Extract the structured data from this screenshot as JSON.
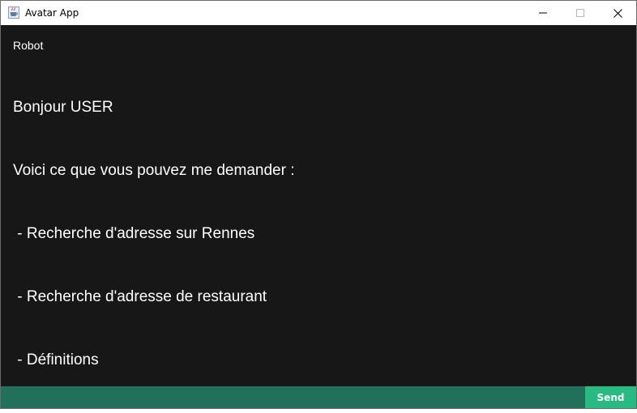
{
  "window": {
    "title": "Avatar App",
    "icon": "java-cup-icon",
    "controls": [
      "minimize-icon",
      "maximize-icon",
      "close-icon"
    ]
  },
  "chat": {
    "sender": "Robot",
    "lines": [
      "Bonjour USER",
      "Voici ce que vous pouvez me demander :",
      " - Recherche d'adresse sur Rennes",
      " - Recherche d'adresse de restaurant",
      " - Définitions"
    ]
  },
  "input": {
    "value": "",
    "placeholder": ""
  },
  "send": {
    "label": "Send"
  },
  "colors": {
    "chat_background": "#171717",
    "input_background": "#21705a",
    "send_button": "#27bb83",
    "text": "#ffffff"
  }
}
